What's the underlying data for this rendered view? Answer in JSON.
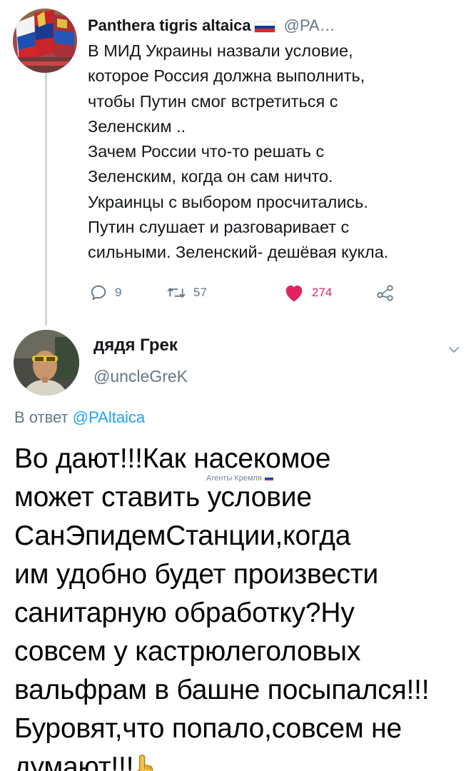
{
  "parent_tweet": {
    "author_name": "Panthera tigris altaica",
    "author_handle": "@PA…",
    "lines": [
      "В МИД Украины назвали условие,",
      "которое Россия должна выполнить,",
      "чтобы Путин смог встретиться с",
      "Зеленским ..",
      "Зачем России что-то решать с",
      "Зеленским, когда он сам ничто.",
      "Украинцы с выбором просчитались.",
      "Путин слушает и разговаривает с",
      "сильными. Зеленский- дешёвая кукла."
    ],
    "replies_count": "9",
    "retweets_count": "57",
    "likes_count": "274",
    "flag_colors": [
      "#ffffff",
      "#0039a6",
      "#d52b1e"
    ]
  },
  "reply_tweet": {
    "author_name": "дядя Грек",
    "author_handle": "@uncleGreK",
    "reply_prefix": "В ответ",
    "reply_mention": "@PAltaica",
    "lines": [
      "Во дают!!!Как насекомое",
      "может ставить условие",
      "СанЭпидемСтанции,когда",
      "им удобно будет произвести",
      "санитарную обработку?Ну",
      "совсем у кастрюлеголовых",
      "вальфрам в башне посыпался!!!",
      "Буровят,что попало,совсем не",
      "думают!!!"
    ]
  },
  "watermark": {
    "text": "Агенты Кремля"
  },
  "colors": {
    "text_primary": "#14171a",
    "text_secondary": "#657786",
    "accent_blue": "#1da1f2",
    "like_red": "#e0245e",
    "thread_line": "#ccd6dd"
  },
  "icons": [
    "reply-icon",
    "retweet-icon",
    "heart-icon",
    "share-icon",
    "chevron-down-icon",
    "hand-point-up-emoji"
  ]
}
